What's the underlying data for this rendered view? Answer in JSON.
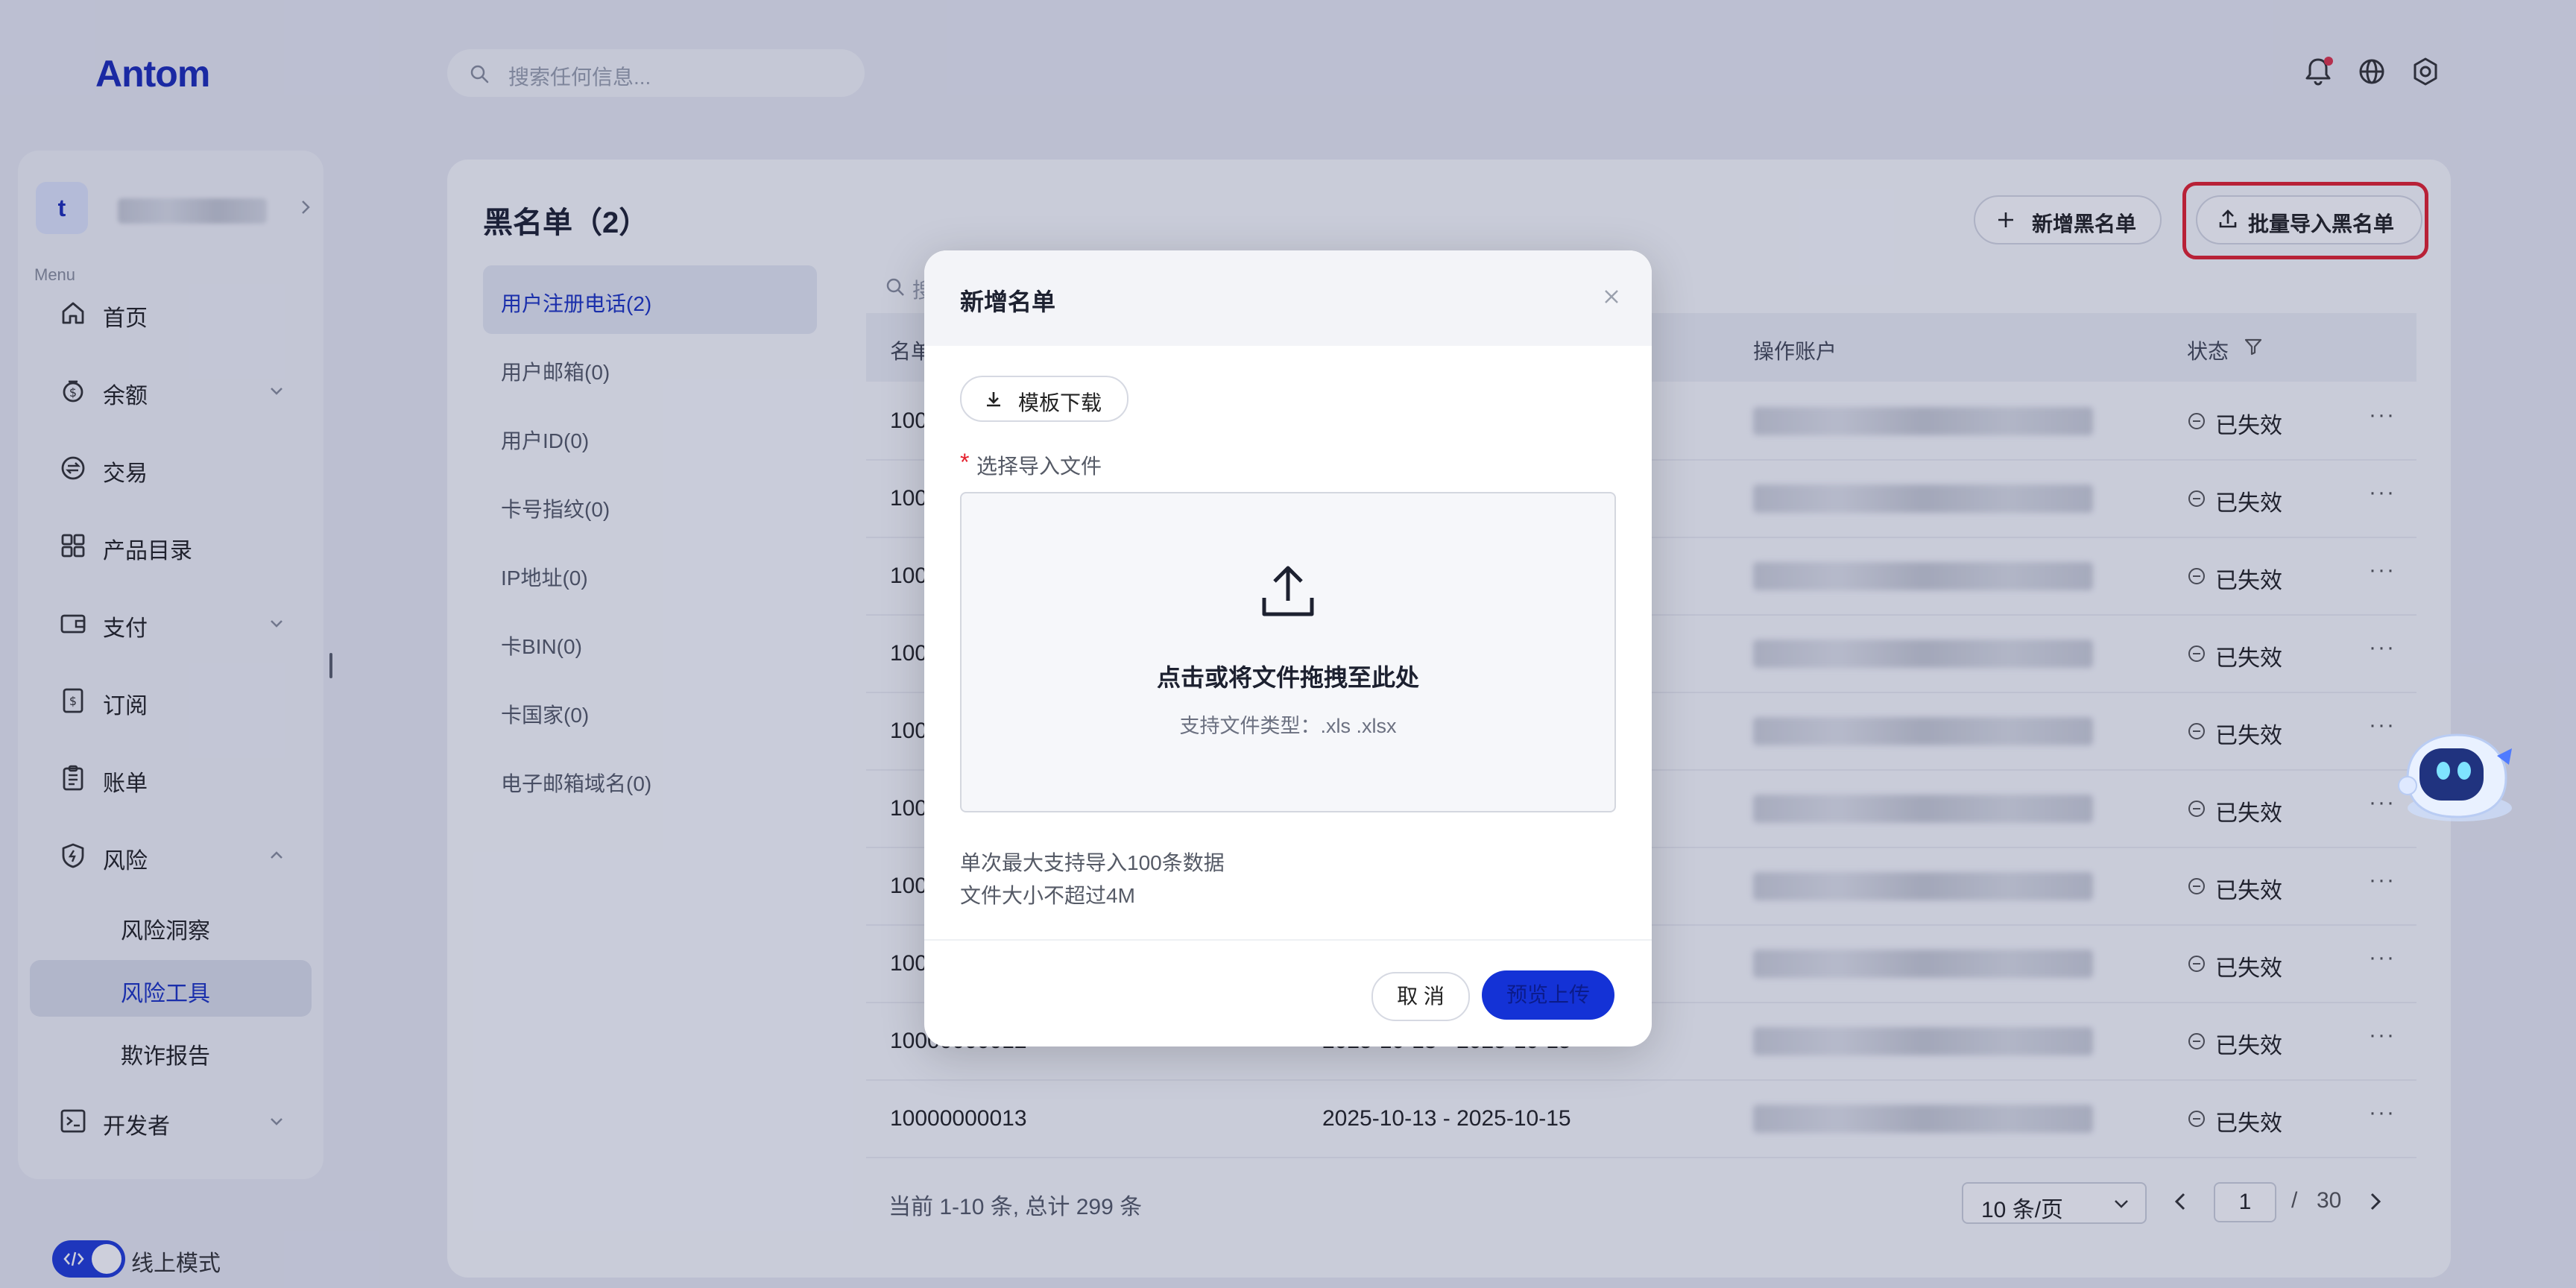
{
  "brand": {
    "logo": "Antom"
  },
  "search": {
    "placeholder": "搜索任何信息..."
  },
  "sidebar": {
    "account_initial": "t",
    "menu_caption": "Menu",
    "items": [
      {
        "label": "首页",
        "icon": "home-icon"
      },
      {
        "label": "余额",
        "icon": "balance-icon",
        "expandable": true
      },
      {
        "label": "交易",
        "icon": "transaction-icon"
      },
      {
        "label": "产品目录",
        "icon": "catalog-icon"
      },
      {
        "label": "支付",
        "icon": "wallet-icon",
        "expandable": true
      },
      {
        "label": "订阅",
        "icon": "subscription-icon"
      },
      {
        "label": "账单",
        "icon": "bill-icon"
      },
      {
        "label": "风险",
        "icon": "shield-icon",
        "expanded": true
      },
      {
        "label": "开发者",
        "icon": "terminal-icon",
        "expandable": true
      }
    ],
    "risk_sub": [
      {
        "label": "风险洞察"
      },
      {
        "label": "风险工具",
        "active": true
      },
      {
        "label": "欺诈报告"
      }
    ],
    "mode_label": "线上模式"
  },
  "page": {
    "title": "黑名单（2）",
    "add_button": "新增黑名单",
    "batch_import_button": "批量导入黑名单"
  },
  "categories": [
    {
      "label": "用户注册电话(2)",
      "active": true
    },
    {
      "label": "用户邮箱(0)"
    },
    {
      "label": "用户ID(0)"
    },
    {
      "label": "卡号指纹(0)"
    },
    {
      "label": "IP地址(0)"
    },
    {
      "label": "卡BIN(0)"
    },
    {
      "label": "卡国家(0)"
    },
    {
      "label": "电子邮箱域名(0)"
    }
  ],
  "table": {
    "search_hint": "搜",
    "columns": {
      "name": "名单",
      "account": "操作账户",
      "status": "状态"
    },
    "rows": [
      {
        "id": "100",
        "period": "",
        "status": "已失效"
      },
      {
        "id": "100",
        "period": "",
        "status": "已失效"
      },
      {
        "id": "100",
        "period": "",
        "status": "已失效"
      },
      {
        "id": "100",
        "period": "",
        "status": "已失效"
      },
      {
        "id": "100",
        "period": "",
        "status": "已失效"
      },
      {
        "id": "100",
        "period": "",
        "status": "已失效"
      },
      {
        "id": "100",
        "period": "",
        "status": "已失效"
      },
      {
        "id": "100",
        "period": "",
        "status": "已失效"
      },
      {
        "id": "10000000012",
        "period": "2025-10-13 - 2025-10-15",
        "status": "已失效"
      },
      {
        "id": "10000000013",
        "period": "2025-10-13 - 2025-10-15",
        "status": "已失效"
      }
    ],
    "more_label": "···"
  },
  "pagination": {
    "summary": "当前 1-10 条, 总计 299 条",
    "page_size": "10 条/页",
    "current_page": "1",
    "separator": "/",
    "total_pages": "30"
  },
  "modal": {
    "title": "新增名单",
    "template_button": "模板下载",
    "required_mark": "*",
    "field_label": "选择导入文件",
    "dropzone_main": "点击或将文件拖拽至此处",
    "dropzone_sub": "支持文件类型：.xls .xlsx",
    "note_1": "单次最大支持导入100条数据",
    "note_2": "文件大小不超过4M",
    "cancel_button": "取 消",
    "upload_button": "预览上传"
  },
  "colors": {
    "brand": "#1a2bb8",
    "primary_button": "#1432d6",
    "highlight": "#e5202d",
    "notification_dot": "#e0334a"
  }
}
